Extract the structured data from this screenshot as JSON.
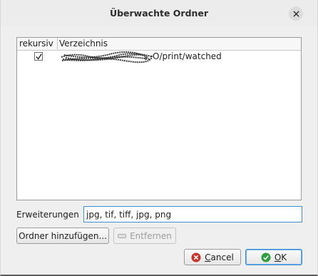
{
  "window": {
    "title": "Überwachte Ordner"
  },
  "table": {
    "columns": [
      "rekursiv",
      "Verzeichnis"
    ],
    "rows": [
      {
        "recursive": true,
        "path_visible": "O/print/watched"
      }
    ]
  },
  "extensions": {
    "label": "Erweiterungen",
    "value": "jpg, tif, tiff, jpg, png"
  },
  "buttons": {
    "add": "Ordner hinzufügen...",
    "remove": "Entfernen",
    "cancel_accel": "C",
    "cancel_rest": "ancel",
    "ok_accel": "O",
    "ok_rest": "K"
  },
  "colors": {
    "accent": "#3d8fd6",
    "ok_icon": "#2e9e3e",
    "cancel_icon": "#c8302a"
  }
}
